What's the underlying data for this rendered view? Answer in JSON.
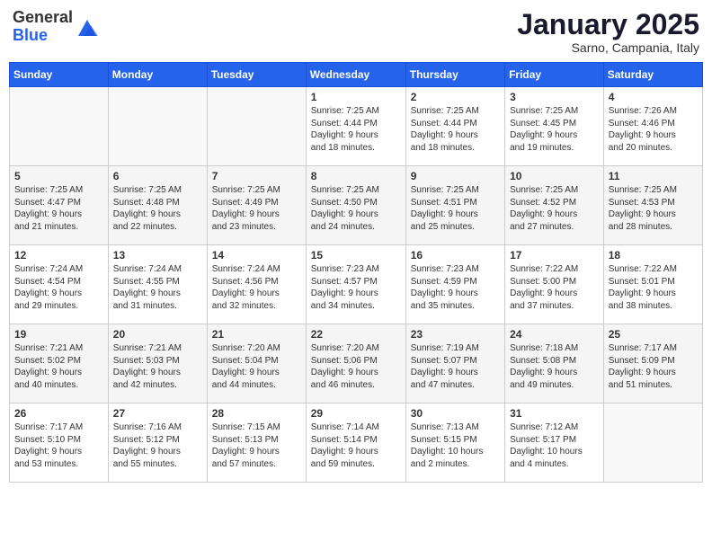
{
  "header": {
    "logo_general": "General",
    "logo_blue": "Blue",
    "month_title": "January 2025",
    "location": "Sarno, Campania, Italy"
  },
  "days_of_week": [
    "Sunday",
    "Monday",
    "Tuesday",
    "Wednesday",
    "Thursday",
    "Friday",
    "Saturday"
  ],
  "weeks": [
    [
      {
        "day": "",
        "info": ""
      },
      {
        "day": "",
        "info": ""
      },
      {
        "day": "",
        "info": ""
      },
      {
        "day": "1",
        "info": "Sunrise: 7:25 AM\nSunset: 4:44 PM\nDaylight: 9 hours\nand 18 minutes."
      },
      {
        "day": "2",
        "info": "Sunrise: 7:25 AM\nSunset: 4:44 PM\nDaylight: 9 hours\nand 18 minutes."
      },
      {
        "day": "3",
        "info": "Sunrise: 7:25 AM\nSunset: 4:45 PM\nDaylight: 9 hours\nand 19 minutes."
      },
      {
        "day": "4",
        "info": "Sunrise: 7:26 AM\nSunset: 4:46 PM\nDaylight: 9 hours\nand 20 minutes."
      }
    ],
    [
      {
        "day": "5",
        "info": "Sunrise: 7:25 AM\nSunset: 4:47 PM\nDaylight: 9 hours\nand 21 minutes."
      },
      {
        "day": "6",
        "info": "Sunrise: 7:25 AM\nSunset: 4:48 PM\nDaylight: 9 hours\nand 22 minutes."
      },
      {
        "day": "7",
        "info": "Sunrise: 7:25 AM\nSunset: 4:49 PM\nDaylight: 9 hours\nand 23 minutes."
      },
      {
        "day": "8",
        "info": "Sunrise: 7:25 AM\nSunset: 4:50 PM\nDaylight: 9 hours\nand 24 minutes."
      },
      {
        "day": "9",
        "info": "Sunrise: 7:25 AM\nSunset: 4:51 PM\nDaylight: 9 hours\nand 25 minutes."
      },
      {
        "day": "10",
        "info": "Sunrise: 7:25 AM\nSunset: 4:52 PM\nDaylight: 9 hours\nand 27 minutes."
      },
      {
        "day": "11",
        "info": "Sunrise: 7:25 AM\nSunset: 4:53 PM\nDaylight: 9 hours\nand 28 minutes."
      }
    ],
    [
      {
        "day": "12",
        "info": "Sunrise: 7:24 AM\nSunset: 4:54 PM\nDaylight: 9 hours\nand 29 minutes."
      },
      {
        "day": "13",
        "info": "Sunrise: 7:24 AM\nSunset: 4:55 PM\nDaylight: 9 hours\nand 31 minutes."
      },
      {
        "day": "14",
        "info": "Sunrise: 7:24 AM\nSunset: 4:56 PM\nDaylight: 9 hours\nand 32 minutes."
      },
      {
        "day": "15",
        "info": "Sunrise: 7:23 AM\nSunset: 4:57 PM\nDaylight: 9 hours\nand 34 minutes."
      },
      {
        "day": "16",
        "info": "Sunrise: 7:23 AM\nSunset: 4:59 PM\nDaylight: 9 hours\nand 35 minutes."
      },
      {
        "day": "17",
        "info": "Sunrise: 7:22 AM\nSunset: 5:00 PM\nDaylight: 9 hours\nand 37 minutes."
      },
      {
        "day": "18",
        "info": "Sunrise: 7:22 AM\nSunset: 5:01 PM\nDaylight: 9 hours\nand 38 minutes."
      }
    ],
    [
      {
        "day": "19",
        "info": "Sunrise: 7:21 AM\nSunset: 5:02 PM\nDaylight: 9 hours\nand 40 minutes."
      },
      {
        "day": "20",
        "info": "Sunrise: 7:21 AM\nSunset: 5:03 PM\nDaylight: 9 hours\nand 42 minutes."
      },
      {
        "day": "21",
        "info": "Sunrise: 7:20 AM\nSunset: 5:04 PM\nDaylight: 9 hours\nand 44 minutes."
      },
      {
        "day": "22",
        "info": "Sunrise: 7:20 AM\nSunset: 5:06 PM\nDaylight: 9 hours\nand 46 minutes."
      },
      {
        "day": "23",
        "info": "Sunrise: 7:19 AM\nSunset: 5:07 PM\nDaylight: 9 hours\nand 47 minutes."
      },
      {
        "day": "24",
        "info": "Sunrise: 7:18 AM\nSunset: 5:08 PM\nDaylight: 9 hours\nand 49 minutes."
      },
      {
        "day": "25",
        "info": "Sunrise: 7:17 AM\nSunset: 5:09 PM\nDaylight: 9 hours\nand 51 minutes."
      }
    ],
    [
      {
        "day": "26",
        "info": "Sunrise: 7:17 AM\nSunset: 5:10 PM\nDaylight: 9 hours\nand 53 minutes."
      },
      {
        "day": "27",
        "info": "Sunrise: 7:16 AM\nSunset: 5:12 PM\nDaylight: 9 hours\nand 55 minutes."
      },
      {
        "day": "28",
        "info": "Sunrise: 7:15 AM\nSunset: 5:13 PM\nDaylight: 9 hours\nand 57 minutes."
      },
      {
        "day": "29",
        "info": "Sunrise: 7:14 AM\nSunset: 5:14 PM\nDaylight: 9 hours\nand 59 minutes."
      },
      {
        "day": "30",
        "info": "Sunrise: 7:13 AM\nSunset: 5:15 PM\nDaylight: 10 hours\nand 2 minutes."
      },
      {
        "day": "31",
        "info": "Sunrise: 7:12 AM\nSunset: 5:17 PM\nDaylight: 10 hours\nand 4 minutes."
      },
      {
        "day": "",
        "info": ""
      }
    ]
  ]
}
